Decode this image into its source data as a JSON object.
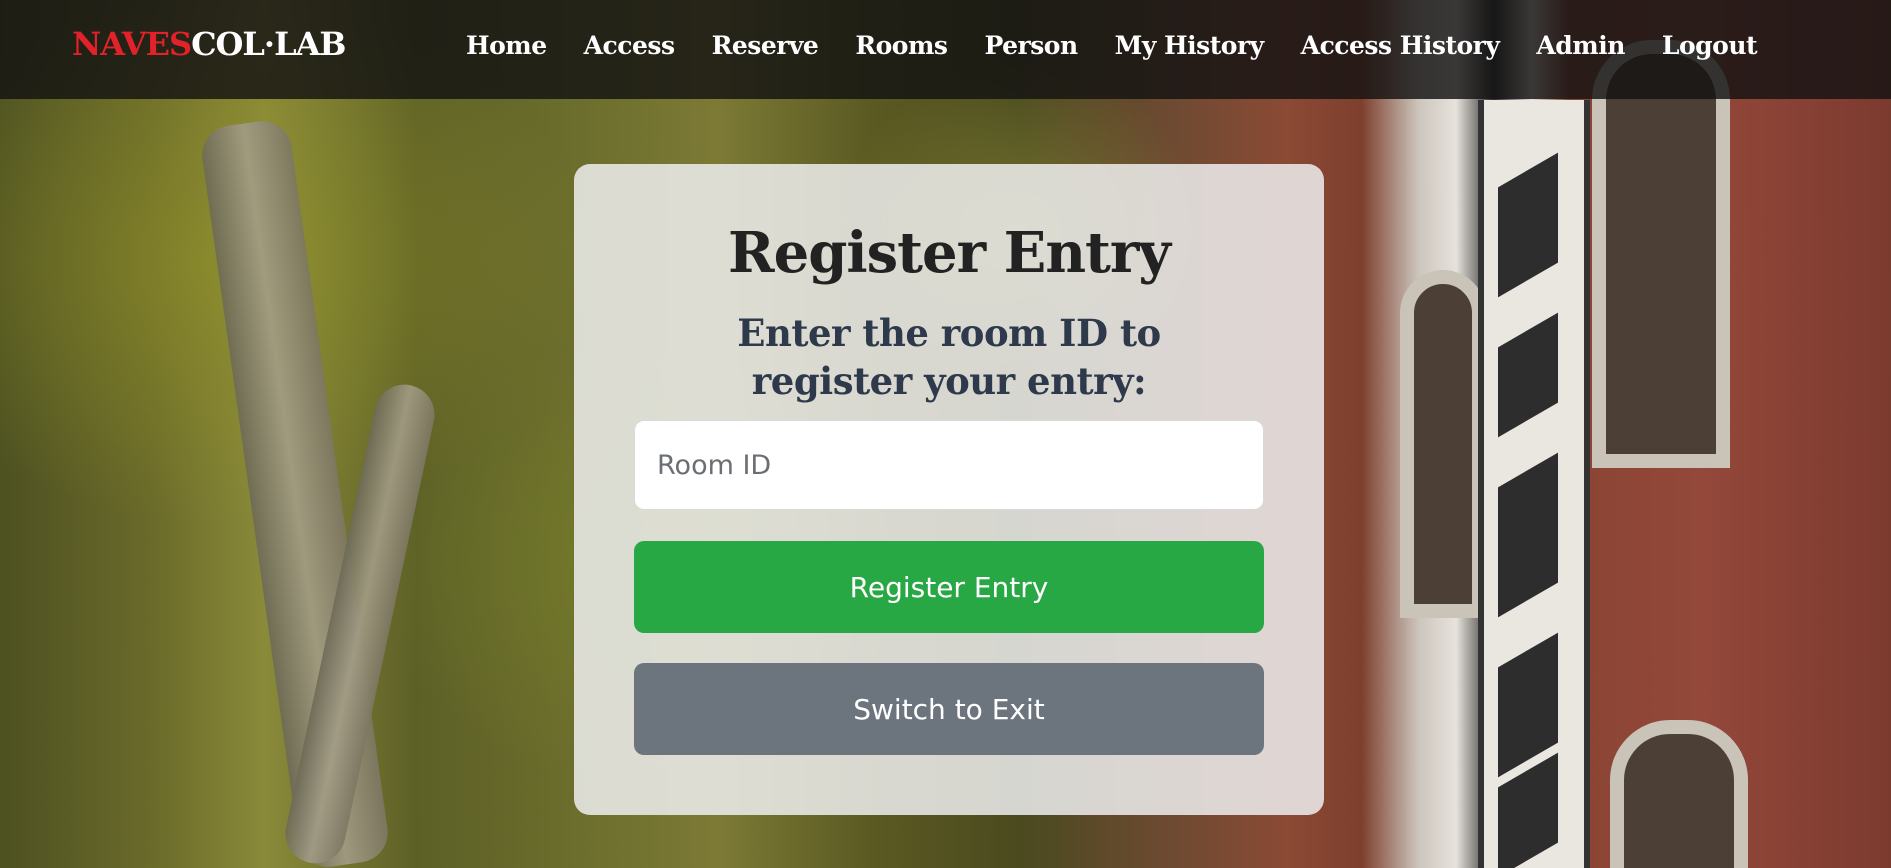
{
  "brand": {
    "part1": "NAVES",
    "part2": "COL·LAB",
    "part1_color": "#e1222a",
    "part2_color": "#ffffff"
  },
  "nav": {
    "items": [
      {
        "label": "Home"
      },
      {
        "label": "Access"
      },
      {
        "label": "Reserve"
      },
      {
        "label": "Rooms"
      },
      {
        "label": "Person"
      },
      {
        "label": "My History"
      },
      {
        "label": "Access History"
      },
      {
        "label": "Admin"
      },
      {
        "label": "Logout"
      }
    ]
  },
  "card": {
    "title": "Register Entry",
    "subtitle": "Enter the room ID to register your entry:",
    "room_input": {
      "value": "",
      "placeholder": "Room ID"
    },
    "register_button_label": "Register Entry",
    "switch_button_label": "Switch to Exit"
  },
  "colors": {
    "navbar_bg": "#141212",
    "success": "#28a745",
    "secondary": "#6c757d",
    "title": "#222222",
    "subtitle": "#2e3a4b"
  }
}
